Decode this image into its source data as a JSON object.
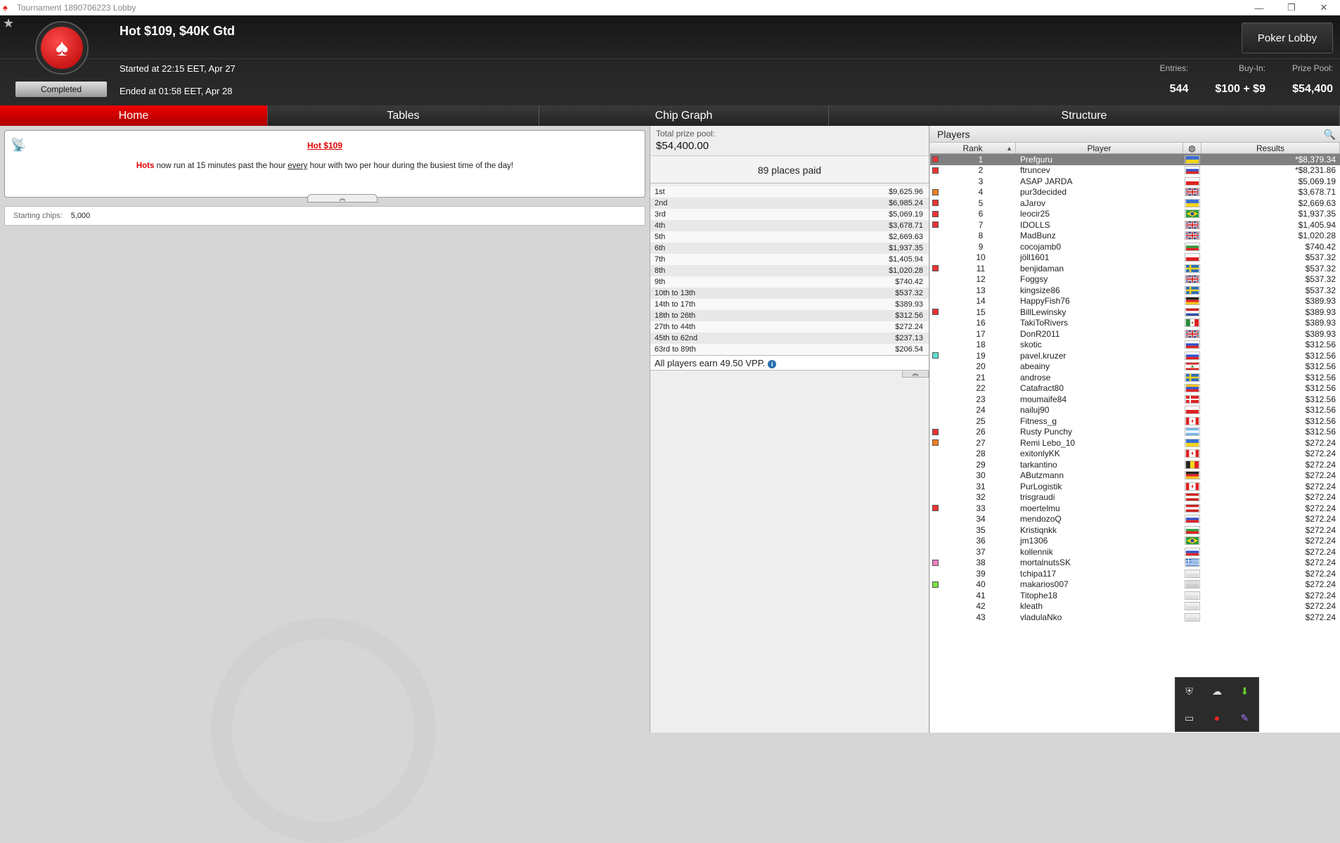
{
  "window": {
    "title": "Tournament 1890706223 Lobby"
  },
  "header": {
    "tournament_name": "Hot $109, $40K Gtd",
    "status": "Completed",
    "started": "Started at 22:15 EET, Apr 27",
    "ended": "Ended at 01:58 EET, Apr 28",
    "lobby_button": "Poker Lobby",
    "entries_label": "Entries:",
    "entries_value": "544",
    "buyin_label": "Buy-In:",
    "buyin_value": "$100 + $9",
    "prizepool_label": "Prize Pool:",
    "prizepool_value": "$54,400"
  },
  "tabs": [
    "Home",
    "Tables",
    "Chip Graph",
    "Structure"
  ],
  "promo": {
    "title": "Hot $109",
    "text_prefix": "Hots",
    "text_1": " now run at 15 minutes past the hour ",
    "text_every": "every",
    "text_2": " hour with two per hour during the busiest time of the day!"
  },
  "starting_chips": {
    "label": "Starting chips:",
    "value": "5,000"
  },
  "prize": {
    "total_label": "Total prize pool:",
    "total_value": "$54,400.00",
    "places_paid": "89 places paid",
    "payouts": [
      [
        "1st",
        "$9,625.96"
      ],
      [
        "2nd",
        "$6,985.24"
      ],
      [
        "3rd",
        "$5,069.19"
      ],
      [
        "4th",
        "$3,678.71"
      ],
      [
        "5th",
        "$2,669.63"
      ],
      [
        "6th",
        "$1,937.35"
      ],
      [
        "7th",
        "$1,405.94"
      ],
      [
        "8th",
        "$1,020.28"
      ],
      [
        "9th",
        "$740.42"
      ],
      [
        "10th to 13th",
        "$537.32"
      ],
      [
        "14th to 17th",
        "$389.93"
      ],
      [
        "18th to 26th",
        "$312.56"
      ],
      [
        "27th to 44th",
        "$272.24"
      ],
      [
        "45th to 62nd",
        "$237.13"
      ],
      [
        "63rd to 89th",
        "$206.54"
      ]
    ],
    "vpp_text": "All players earn 49.50 VPP."
  },
  "players": {
    "title": "Players",
    "columns": {
      "rank": "Rank",
      "player": "Player",
      "results": "Results"
    },
    "rows": [
      {
        "rank": "1",
        "name": "Prefguru",
        "res": "*$8,379.34",
        "marker": "#e33",
        "flag": [
          "#3b6fd4",
          "#f3d31a"
        ]
      },
      {
        "rank": "2",
        "name": "ftruncev",
        "res": "*$8,231.86",
        "marker": "#e33",
        "flag": [
          "#fff",
          "#2b4fd0",
          "#d22"
        ]
      },
      {
        "rank": "3",
        "name": "ASAP JARDA",
        "res": "$5,069.19",
        "marker": "",
        "flag": [
          "#fff",
          "#d22"
        ]
      },
      {
        "rank": "4",
        "name": "pur3decided",
        "res": "$3,678.71",
        "marker": "#f07f20",
        "flag": [
          "uk"
        ]
      },
      {
        "rank": "5",
        "name": "aJarov",
        "res": "$2,669.63",
        "marker": "#e33",
        "flag": [
          "#3b6fd4",
          "#f3d31a"
        ]
      },
      {
        "rank": "6",
        "name": "leocir25",
        "res": "$1,937.35",
        "marker": "#e33",
        "flag": [
          "br"
        ]
      },
      {
        "rank": "7",
        "name": "IDOLLS",
        "res": "$1,405.94",
        "marker": "#e33",
        "flag": [
          "uk"
        ]
      },
      {
        "rank": "8",
        "name": "MadBunz",
        "res": "$1,020.28",
        "marker": "",
        "flag": [
          "uk"
        ]
      },
      {
        "rank": "9",
        "name": "cocojamb0",
        "res": "$740.42",
        "marker": "",
        "flag": [
          "#fff",
          "#2a9a3a",
          "#d22"
        ]
      },
      {
        "rank": "10",
        "name": "jöll1601",
        "res": "$537.32",
        "marker": "",
        "flag": [
          "#fff",
          "#d22"
        ]
      },
      {
        "rank": "11",
        "name": "benjidaman",
        "res": "$537.32",
        "marker": "#e33",
        "flag": [
          "se"
        ]
      },
      {
        "rank": "12",
        "name": "Foggsy",
        "res": "$537.32",
        "marker": "",
        "flag": [
          "uk"
        ]
      },
      {
        "rank": "13",
        "name": "kingsize86",
        "res": "$537.32",
        "marker": "",
        "flag": [
          "se"
        ]
      },
      {
        "rank": "14",
        "name": "HappyFish76",
        "res": "$389.93",
        "marker": "",
        "flag": [
          "#222",
          "#d22",
          "#f3c21a"
        ]
      },
      {
        "rank": "15",
        "name": "BillLewinsky",
        "res": "$389.93",
        "marker": "#e33",
        "flag": [
          "#c22",
          "#fff",
          "#2b4fa0"
        ]
      },
      {
        "rank": "16",
        "name": "TakiToRivers",
        "res": "$389.93",
        "marker": "",
        "flag": [
          "mx"
        ]
      },
      {
        "rank": "17",
        "name": "DonR2011",
        "res": "$389.93",
        "marker": "",
        "flag": [
          "uk"
        ]
      },
      {
        "rank": "18",
        "name": "skotic",
        "res": "$312.56",
        "marker": "",
        "flag": [
          "#fff",
          "#2b4fd0",
          "#d22"
        ]
      },
      {
        "rank": "19",
        "name": "pavel.kruzer",
        "res": "$312.56",
        "marker": "#5fe0d0",
        "flag": [
          "#fff",
          "#2b4fd0",
          "#d22"
        ]
      },
      {
        "rank": "20",
        "name": "abeainy",
        "res": "$312.56",
        "marker": "",
        "flag": [
          "lb"
        ]
      },
      {
        "rank": "21",
        "name": "androse",
        "res": "$312.56",
        "marker": "",
        "flag": [
          "se"
        ]
      },
      {
        "rank": "22",
        "name": "Catafract80",
        "res": "$312.56",
        "marker": "",
        "flag": [
          "#f3c21a",
          "#2b4fd0",
          "#d22"
        ]
      },
      {
        "rank": "23",
        "name": "moumaife84",
        "res": "$312.56",
        "marker": "",
        "flag": [
          "dk"
        ]
      },
      {
        "rank": "24",
        "name": "nailuj90",
        "res": "$312.56",
        "marker": "",
        "flag": [
          "#fff",
          "#d22"
        ]
      },
      {
        "rank": "25",
        "name": "Fitness_g",
        "res": "$312.56",
        "marker": "",
        "flag": [
          "ca"
        ]
      },
      {
        "rank": "26",
        "name": "Rusty Punchy",
        "res": "$312.56",
        "marker": "#e33",
        "flag": [
          "#7ab4e8",
          "#fff",
          "#7ab4e8"
        ]
      },
      {
        "rank": "27",
        "name": "Remi Lebo_10",
        "res": "$272.24",
        "marker": "#f07f20",
        "flag": [
          "#3b6fd4",
          "#f3d31a"
        ]
      },
      {
        "rank": "28",
        "name": "exitonlyKK",
        "res": "$272.24",
        "marker": "",
        "flag": [
          "ca"
        ]
      },
      {
        "rank": "29",
        "name": "tarkantino",
        "res": "$272.24",
        "marker": "",
        "flag": [
          "be"
        ]
      },
      {
        "rank": "30",
        "name": "AButzmann",
        "res": "$272.24",
        "marker": "",
        "flag": [
          "#222",
          "#d22",
          "#f3c21a"
        ]
      },
      {
        "rank": "31",
        "name": "PurLogistik",
        "res": "$272.24",
        "marker": "",
        "flag": [
          "ca"
        ]
      },
      {
        "rank": "32",
        "name": "trisgraudi",
        "res": "$272.24",
        "marker": "",
        "flag": [
          "#c22",
          "#fff",
          "#c22"
        ]
      },
      {
        "rank": "33",
        "name": "moertelmu",
        "res": "$272.24",
        "marker": "#e33",
        "flag": [
          "#c22",
          "#fff",
          "#c22"
        ]
      },
      {
        "rank": "34",
        "name": "mendozoQ",
        "res": "$272.24",
        "marker": "",
        "flag": [
          "#fff",
          "#2b4fd0",
          "#d22"
        ]
      },
      {
        "rank": "35",
        "name": "Kristiqnkk",
        "res": "$272.24",
        "marker": "",
        "flag": [
          "#fff",
          "#2a9a3a",
          "#d22"
        ]
      },
      {
        "rank": "36",
        "name": "jm1306",
        "res": "$272.24",
        "marker": "",
        "flag": [
          "br"
        ]
      },
      {
        "rank": "37",
        "name": "kollennik",
        "res": "$272.24",
        "marker": "",
        "flag": [
          "#fff",
          "#2b4fd0",
          "#d22"
        ]
      },
      {
        "rank": "38",
        "name": "mortalnutsSK",
        "res": "$272.24",
        "marker": "#f07fc0",
        "flag": [
          "gr"
        ]
      },
      {
        "rank": "39",
        "name": "tchipa117",
        "res": "$272.24",
        "marker": "",
        "flag": [
          "#eee",
          "#ddd"
        ]
      },
      {
        "rank": "40",
        "name": "makarios007",
        "res": "$272.24",
        "marker": "#7fe040",
        "flag": [
          "#ddd",
          "#ccc"
        ]
      },
      {
        "rank": "41",
        "name": "Titophe18",
        "res": "$272.24",
        "marker": "",
        "flag": [
          "#eee",
          "#ddd"
        ]
      },
      {
        "rank": "42",
        "name": "kleath",
        "res": "$272.24",
        "marker": "",
        "flag": [
          "#eee",
          "#ddd"
        ]
      },
      {
        "rank": "43",
        "name": "vladulaNko",
        "res": "$272.24",
        "marker": "",
        "flag": [
          "#eee",
          "#ddd"
        ]
      }
    ]
  }
}
